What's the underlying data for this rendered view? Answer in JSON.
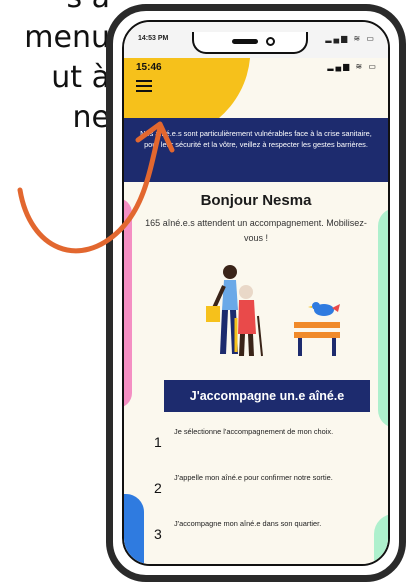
{
  "side_text": {
    "line0": "s à",
    "line1": "menu",
    "line2": "ut à",
    "line3": "ne"
  },
  "outer_status": {
    "time": "14:53 PM",
    "icons": "▂▄▆ ≋ ▭"
  },
  "app": {
    "status_time": "15:46",
    "status_icons": "▂▄▆ ≋ ▭",
    "banner_text": "Nos aîné.e.s sont particulièrement vulnérables face à la crise sanitaire, pour leur sécurité et la vôtre, veillez à respecter les gestes barrières.",
    "greeting": "Bonjour Nesma",
    "subtitle": "165 aîné.e.s attendent un accompagnement. Mobilisez-vous !",
    "cta_label": "J'accompagne un.e aîné.e",
    "steps": [
      {
        "num": "1",
        "text": "Je sélectionne l'accompagnement de mon choix."
      },
      {
        "num": "2",
        "text": "J'appelle mon aîné.e pour confirmer notre sortie."
      },
      {
        "num": "3",
        "text": "J'accompagne mon aîné.e dans son quartier."
      }
    ]
  },
  "colors": {
    "brand_navy": "#1d2b6e",
    "accent_yellow": "#f6c11b",
    "accent_pink": "#f48fc3",
    "accent_mint": "#aef0cd",
    "accent_blue": "#2f7be0",
    "annotation_orange": "#e2672f"
  }
}
